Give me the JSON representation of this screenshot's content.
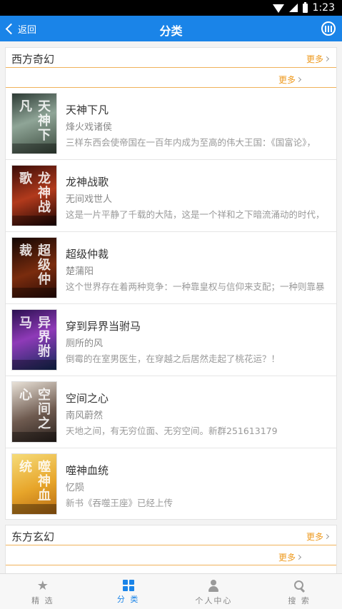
{
  "status_bar": {
    "time": "1:23"
  },
  "app_bar": {
    "back_label": "返回",
    "title": "分类"
  },
  "sections": [
    {
      "title": "西方奇幻",
      "more_label": "更多",
      "sub_more_label": "更多",
      "books": [
        {
          "title": "天神下凡",
          "author": "烽火戏诸侯",
          "description": "三样东西会使帝国在一百年内成为至高的伟大王国：《国富论》，",
          "cover_text": "天神下凡"
        },
        {
          "title": "龙神战歌",
          "author": "无间戏世人",
          "description": "这是一片平静了千载的大陆，这是一个祥和之下暗流涌动的时代，",
          "cover_text": "龙神战歌"
        },
        {
          "title": "超级仲裁",
          "author": "楚蒲阳",
          "description": "这个世界存在着两种竞争：一种靠皇权与信仰来支配；一种则靠暴",
          "cover_text": "超级仲裁"
        },
        {
          "title": "穿到异界当驸马",
          "author": "厕所的风",
          "description": "倒霉的在室男医生，在穿越之后居然走起了桃花运？！",
          "cover_text": "异界驸马"
        },
        {
          "title": "空间之心",
          "author": "南风蔚然",
          "description": "天地之间，有无穷位面、无穷空间。新群251613179",
          "cover_text": "空间之心"
        },
        {
          "title": "噬神血统",
          "author": "忆陨",
          "description": "新书《吞噬王座》已经上传",
          "cover_text": "噬神血统"
        }
      ]
    },
    {
      "title": "东方玄幻",
      "more_label": "更多",
      "sub_more_label": "更多"
    }
  ],
  "tab_bar": {
    "tabs": [
      {
        "label": "精 选",
        "icon": "star-icon"
      },
      {
        "label": "分 类",
        "icon": "grid-icon",
        "active": true
      },
      {
        "label": "个人中心",
        "icon": "person-icon"
      },
      {
        "label": "搜 索",
        "icon": "search-icon"
      }
    ]
  },
  "colors": {
    "primary": "#1a84e8",
    "accent": "#ee9a1f"
  }
}
